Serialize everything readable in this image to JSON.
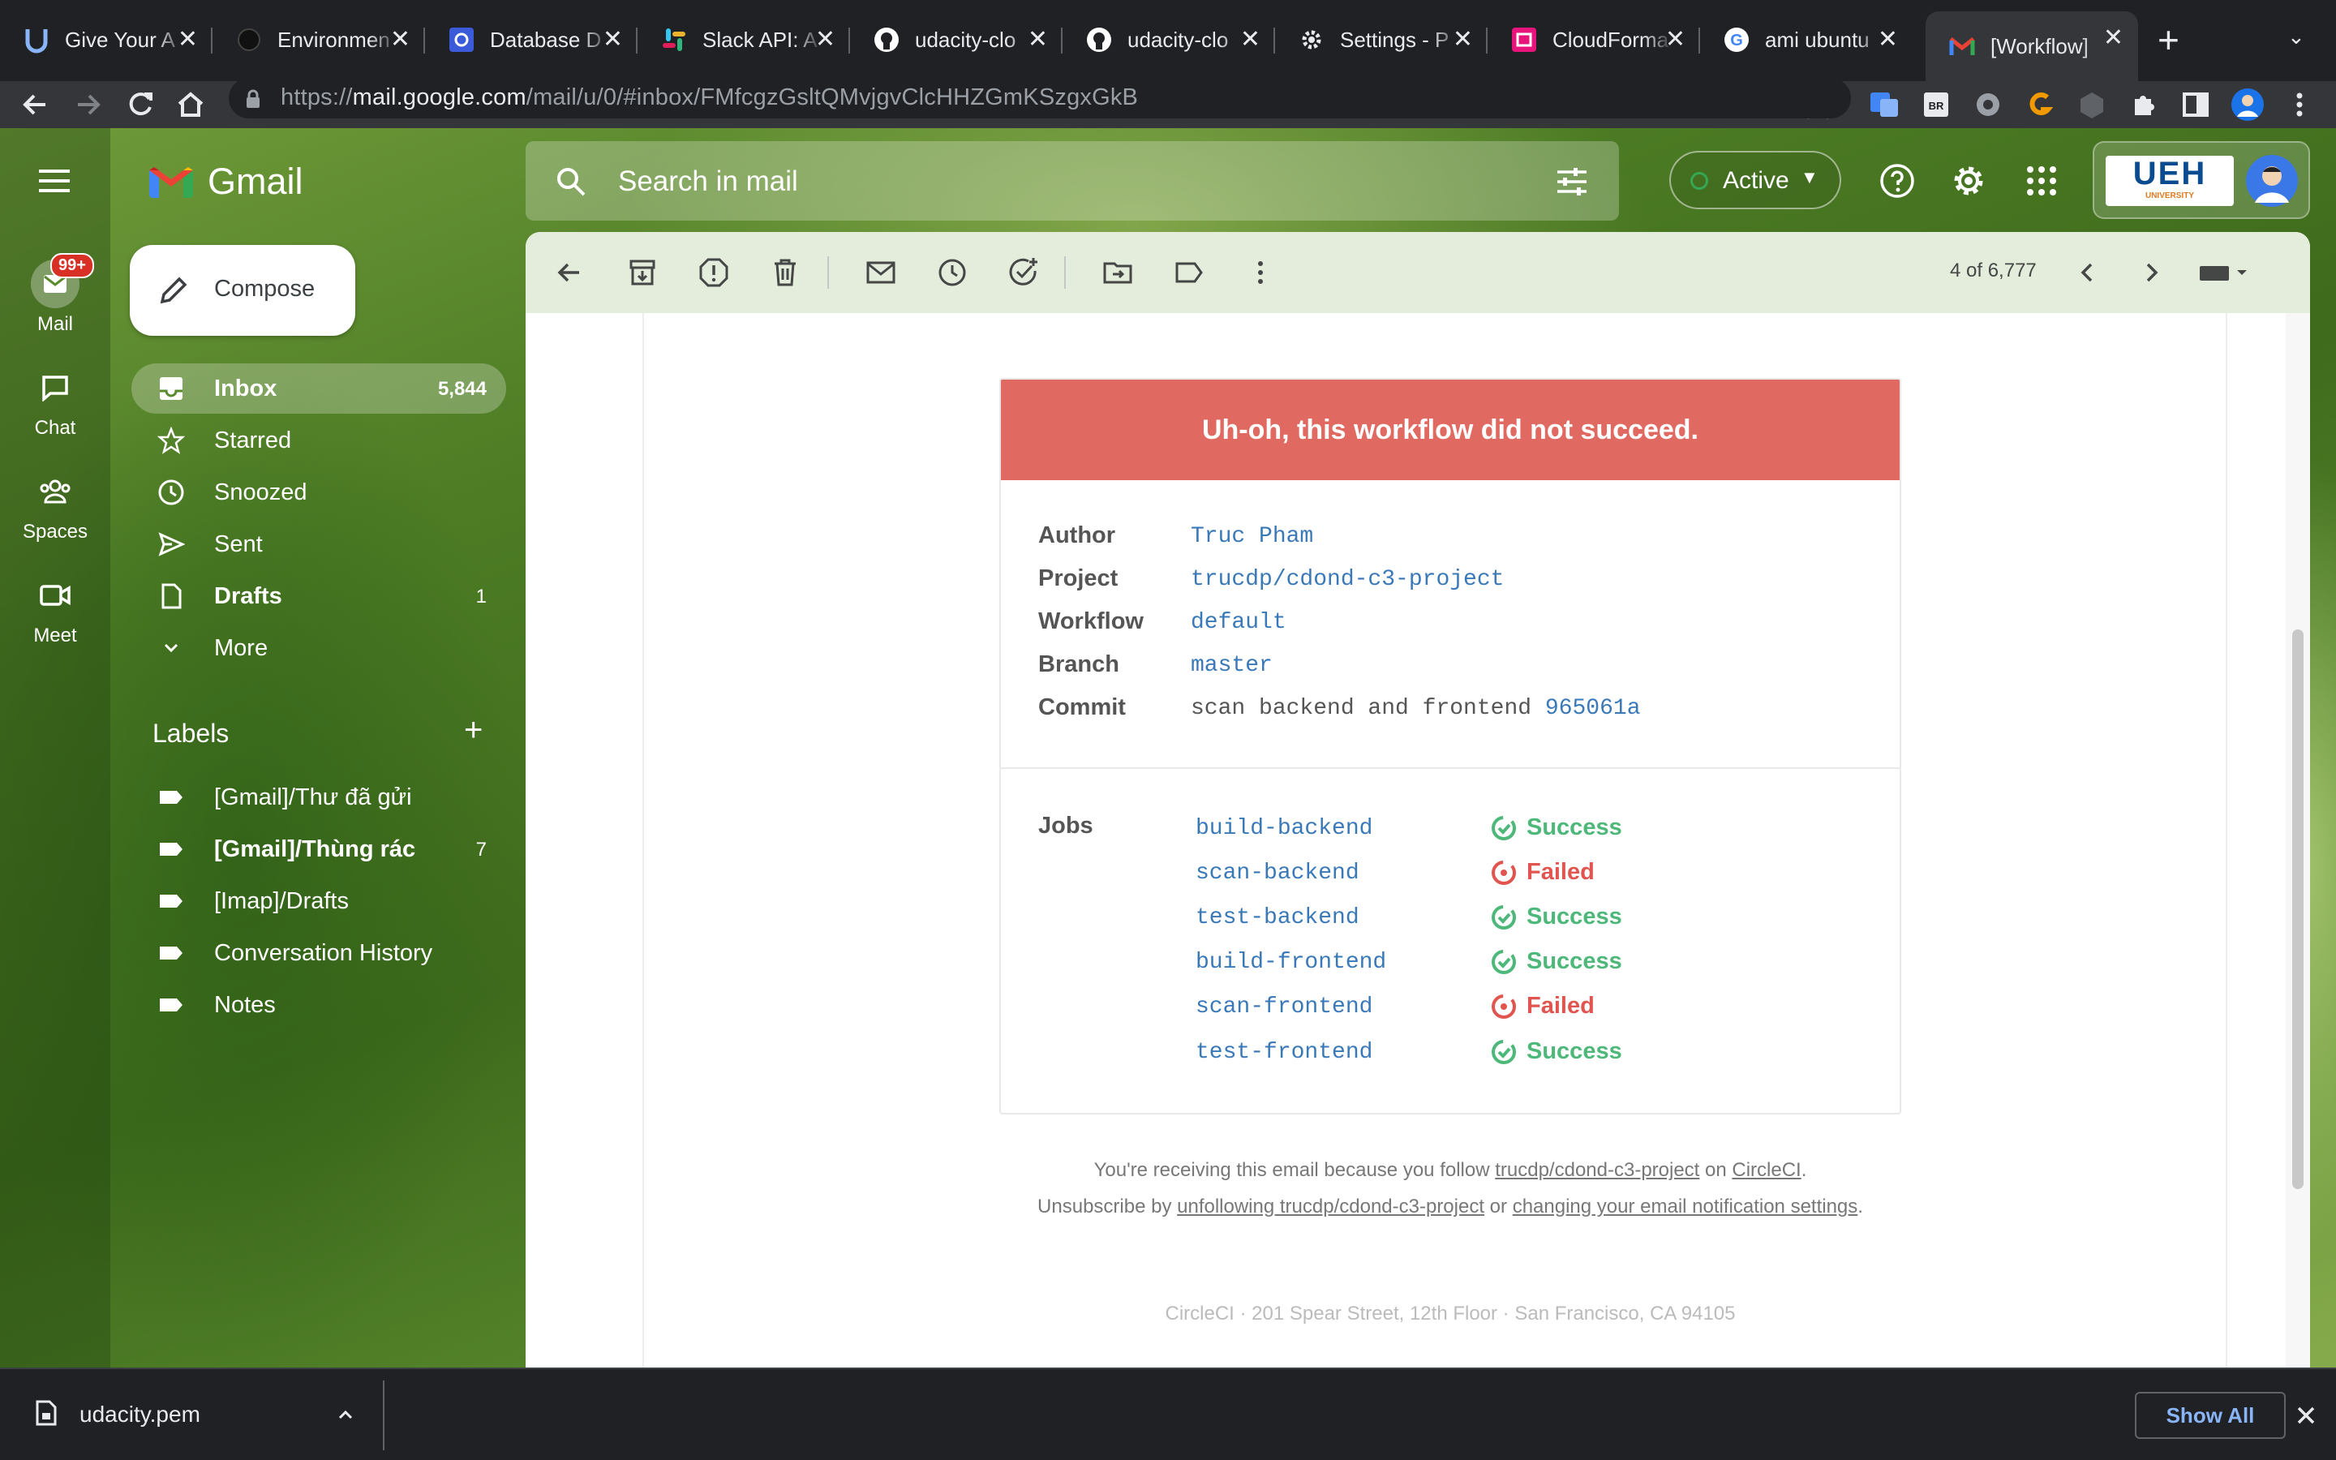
{
  "browser": {
    "tabs": [
      {
        "title": "Give Your A",
        "icon": "udacity-icon"
      },
      {
        "title": "Environmen",
        "icon": "github-icon"
      },
      {
        "title": "Database D",
        "icon": "database-icon"
      },
      {
        "title": "Slack API: A",
        "icon": "slack-icon"
      },
      {
        "title": "udacity-clo",
        "icon": "github-icon"
      },
      {
        "title": "udacity-clo",
        "icon": "github-icon"
      },
      {
        "title": "Settings - P",
        "icon": "gear-icon"
      },
      {
        "title": "CloudForma",
        "icon": "cloudformation-icon"
      },
      {
        "title": "ami ubuntu",
        "icon": "google-icon"
      },
      {
        "title": "[Workflow]",
        "icon": "gmail-icon"
      }
    ],
    "url_prefix": "https://",
    "url_host": "mail.google.com",
    "url_path": "/mail/u/0/#inbox/FMfcgzGsltQMvjgvClcHHZGmKSzgxGkB"
  },
  "gmail": {
    "logo_text": "Gmail",
    "search_placeholder": "Search in mail",
    "status": "Active",
    "account_logo": "UEH",
    "account_logo_sub": "UNIVERSITY",
    "rail": [
      {
        "label": "Mail",
        "badge": "99+"
      },
      {
        "label": "Chat"
      },
      {
        "label": "Spaces"
      },
      {
        "label": "Meet"
      }
    ],
    "compose_label": "Compose",
    "nav": [
      {
        "label": "Inbox",
        "count": "5,844"
      },
      {
        "label": "Starred",
        "count": ""
      },
      {
        "label": "Snoozed",
        "count": ""
      },
      {
        "label": "Sent",
        "count": ""
      },
      {
        "label": "Drafts",
        "count": "1"
      },
      {
        "label": "More",
        "count": ""
      }
    ],
    "labels_title": "Labels",
    "labels": [
      {
        "label": "[Gmail]/Thư đã gửi",
        "count": ""
      },
      {
        "label": "[Gmail]/Thùng rác",
        "count": "7"
      },
      {
        "label": "[Imap]/Drafts",
        "count": ""
      },
      {
        "label": "Conversation History",
        "count": ""
      },
      {
        "label": "Notes",
        "count": ""
      }
    ],
    "page_count": "4 of 6,777"
  },
  "email": {
    "banner": "Uh-oh, this workflow did not succeed.",
    "details": [
      {
        "key": "Author",
        "value": "Truc Pham"
      },
      {
        "key": "Project",
        "value": "trucdp/cdond-c3-project"
      },
      {
        "key": "Workflow",
        "value": "default"
      },
      {
        "key": "Branch",
        "value": "master"
      },
      {
        "key": "Commit",
        "value": "scan backend and frontend",
        "hash": "965061a"
      }
    ],
    "jobs_title": "Jobs",
    "jobs": [
      {
        "name": "build-backend",
        "status": "Success"
      },
      {
        "name": "scan-backend",
        "status": "Failed"
      },
      {
        "name": "test-backend",
        "status": "Success"
      },
      {
        "name": "build-frontend",
        "status": "Success"
      },
      {
        "name": "scan-frontend",
        "status": "Failed"
      },
      {
        "name": "test-frontend",
        "status": "Success"
      }
    ],
    "footer": {
      "p1": "You're receiving this email because you follow ",
      "link1": "trucdp/cdond-c3-project",
      "p2": " on ",
      "link2": "CircleCI",
      "p3": ".",
      "p4": "Unsubscribe by ",
      "link3": "unfollowing trucdp/cdond-c3-project",
      "p5": " or ",
      "link4": "changing your email notification settings",
      "p6": ".",
      "address": "CircleCI · 201 Spear Street, 12th Floor · San Francisco, CA 94105"
    }
  },
  "downloads": {
    "file": "udacity.pem",
    "show_all": "Show All"
  },
  "colors": {
    "banner": "#e06a62",
    "success": "#4db879",
    "failed": "#e0554f",
    "link": "#3a79b8"
  }
}
